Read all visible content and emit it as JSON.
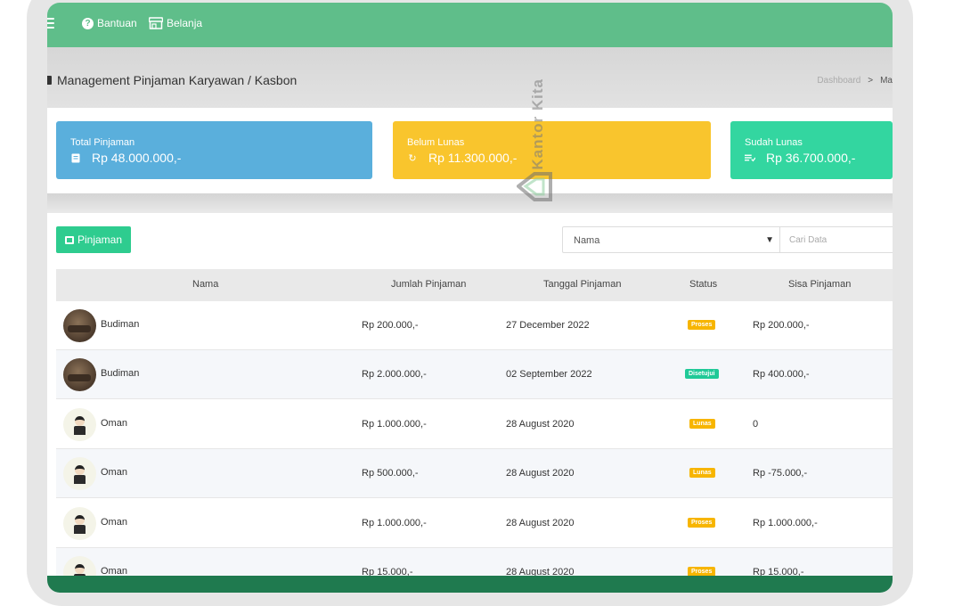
{
  "topbar": {
    "help_label": "Bantuan",
    "shop_label": "Belanja"
  },
  "page": {
    "title": "Management Pinjaman Karyawan / Kasbon",
    "breadcrumb_home": "Dashboard",
    "breadcrumb_sep": ">",
    "breadcrumb_current": "Ma"
  },
  "cards": [
    {
      "label": "Total Pinjaman",
      "value": "Rp 48.000.000,-",
      "color": "#5aafdc",
      "icon": "document-icon"
    },
    {
      "label": "Belum Lunas",
      "value": "Rp 11.300.000,-",
      "color": "#f9c52d",
      "icon": "refresh-icon"
    },
    {
      "label": "Sudah Lunas",
      "value": "Rp 36.700.000,-",
      "color": "#33d6a0",
      "icon": "money-icon"
    }
  ],
  "toolbar": {
    "add_label": "Pinjaman",
    "filter_value": "Nama",
    "search_placeholder": "Cari Data"
  },
  "table": {
    "headers": [
      "Nama",
      "Jumlah Pinjaman",
      "Tanggal Pinjaman",
      "Status",
      "Sisa Pinjaman"
    ],
    "rows": [
      {
        "name": "Budiman",
        "amount": "Rp 200.000,-",
        "date": "27 December 2022",
        "status": "Proses",
        "remaining": "Rp 200.000,-",
        "avatar": "photo"
      },
      {
        "name": "Budiman",
        "amount": "Rp 2.000.000,-",
        "date": "02 September 2022",
        "status": "Disetujui",
        "remaining": "Rp 400.000,-",
        "avatar": "photo"
      },
      {
        "name": "Oman",
        "amount": "Rp 1.000.000,-",
        "date": "28 August 2020",
        "status": "Lunas",
        "remaining": "0",
        "avatar": "cartoon"
      },
      {
        "name": "Oman",
        "amount": "Rp 500.000,-",
        "date": "28 August 2020",
        "status": "Lunas",
        "remaining": "Rp -75.000,-",
        "avatar": "cartoon"
      },
      {
        "name": "Oman",
        "amount": "Rp 1.000.000,-",
        "date": "28 August 2020",
        "status": "Proses",
        "remaining": "Rp 1.000.000,-",
        "avatar": "cartoon"
      },
      {
        "name": "Oman",
        "amount": "Rp 15.000,-",
        "date": "28 August 2020",
        "status": "Proses",
        "remaining": "Rp 15.000,-",
        "avatar": "cartoon"
      }
    ]
  },
  "status_colors": {
    "Proses": "#f7b500",
    "Disetujui": "#20c997",
    "Lunas": "#f7b500"
  },
  "watermark": {
    "text": "Kantor Kita"
  }
}
